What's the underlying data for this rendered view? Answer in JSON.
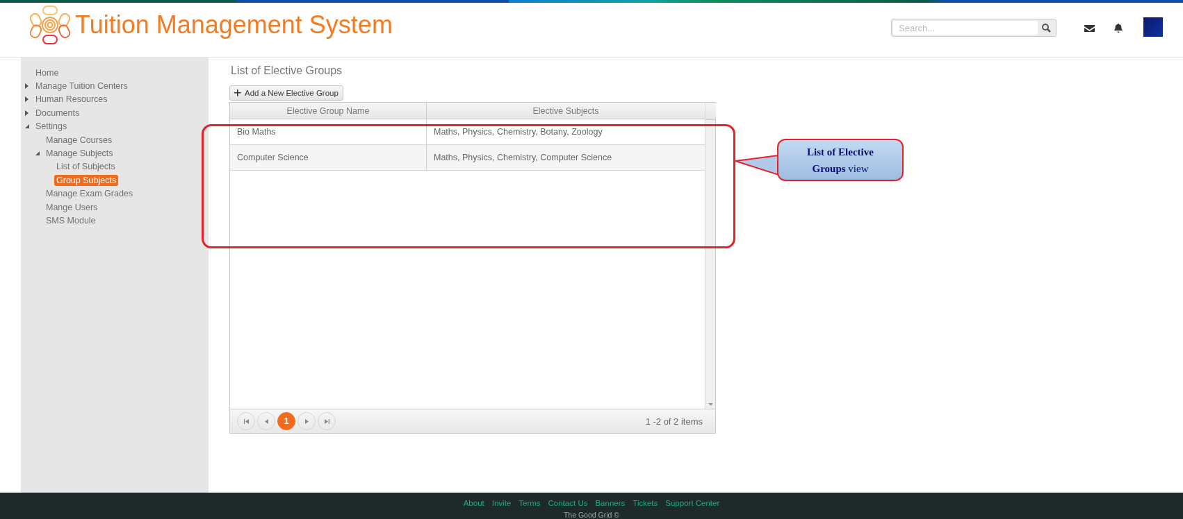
{
  "header": {
    "title": "Tuition Management System",
    "search": {
      "placeholder": "Search..."
    }
  },
  "sidebar": {
    "items": [
      {
        "label": "Home",
        "selected": false
      },
      {
        "label": "Manage Tuition Centers",
        "expanded": false,
        "selected": false
      },
      {
        "label": "Human Resources",
        "expanded": false,
        "selected": false
      },
      {
        "label": "Documents",
        "expanded": false,
        "selected": false
      },
      {
        "label": "Settings",
        "expanded": true,
        "selected": false,
        "children": [
          {
            "label": "Manage Courses",
            "selected": false
          },
          {
            "label": "Manage Subjects",
            "expanded": true,
            "selected": false,
            "children": [
              {
                "label": "List of Subjects",
                "selected": false
              },
              {
                "label": "Group Subjects",
                "selected": true
              }
            ]
          },
          {
            "label": "Manage Exam Grades",
            "selected": false
          },
          {
            "label": "Mange Users",
            "selected": false
          },
          {
            "label": "SMS Module",
            "selected": false
          }
        ]
      }
    ]
  },
  "page": {
    "title": "List of Elective Groups",
    "add_button": "Add a New Elective Group"
  },
  "table": {
    "columns": [
      "Elective Group Name",
      "Elective Subjects"
    ],
    "rows": [
      [
        "Bio Maths",
        "Maths, Physics, Chemistry, Botany, Zoology"
      ],
      [
        "Computer Science",
        "Maths, Physics, Chemistry, Computer Science"
      ]
    ]
  },
  "pager": {
    "pages": [
      {
        "label": "1",
        "selected": true
      }
    ],
    "info": "1 -2 of 2 items"
  },
  "callout": {
    "text": "**List of Elective Groups** view"
  },
  "footer": {
    "links": [
      "About",
      "Invite",
      "Terms",
      "Contact Us",
      "Banners",
      "Tickets",
      "Support Center"
    ],
    "copyright": "The Good Grid ©"
  }
}
